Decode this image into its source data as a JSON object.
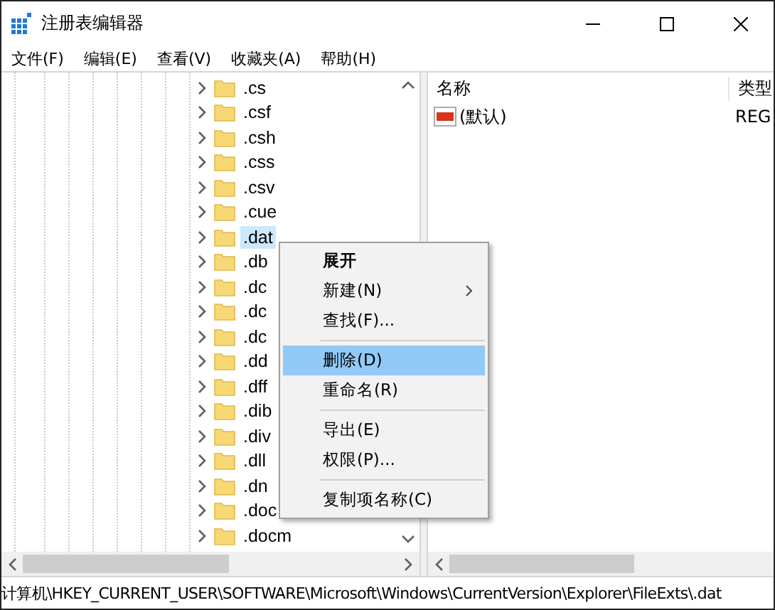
{
  "window": {
    "title": "注册表编辑器"
  },
  "menu_bar": [
    "文件(F)",
    "编辑(E)",
    "查看(V)",
    "收藏夹(A)",
    "帮助(H)"
  ],
  "tree": {
    "items": [
      {
        "label": ".cs",
        "selected": false
      },
      {
        "label": ".csf",
        "selected": false
      },
      {
        "label": ".csh",
        "selected": false
      },
      {
        "label": ".css",
        "selected": false
      },
      {
        "label": ".csv",
        "selected": false
      },
      {
        "label": ".cue",
        "selected": false
      },
      {
        "label": ".dat",
        "selected": true
      },
      {
        "label": ".db",
        "selected": false
      },
      {
        "label": ".dc",
        "selected": false
      },
      {
        "label": ".dc",
        "selected": false
      },
      {
        "label": ".dc",
        "selected": false
      },
      {
        "label": ".dd",
        "selected": false
      },
      {
        "label": ".dff",
        "selected": false
      },
      {
        "label": ".dib",
        "selected": false
      },
      {
        "label": ".div",
        "selected": false
      },
      {
        "label": ".dll",
        "selected": false
      },
      {
        "label": ".dn",
        "selected": false
      },
      {
        "label": ".doc",
        "selected": false
      },
      {
        "label": ".docm",
        "selected": false
      }
    ]
  },
  "context_menu": [
    {
      "kind": "item",
      "label": "展开",
      "bold": true,
      "submenu": false,
      "selected": false
    },
    {
      "kind": "item",
      "label": "新建(N)",
      "bold": false,
      "submenu": true,
      "selected": false
    },
    {
      "kind": "item",
      "label": "查找(F)...",
      "bold": false,
      "submenu": false,
      "selected": false
    },
    {
      "kind": "separator"
    },
    {
      "kind": "item",
      "label": "删除(D)",
      "bold": false,
      "submenu": false,
      "selected": true
    },
    {
      "kind": "item",
      "label": "重命名(R)",
      "bold": false,
      "submenu": false,
      "selected": false
    },
    {
      "kind": "separator"
    },
    {
      "kind": "item",
      "label": "导出(E)",
      "bold": false,
      "submenu": false,
      "selected": false
    },
    {
      "kind": "item",
      "label": "权限(P)...",
      "bold": false,
      "submenu": false,
      "selected": false
    },
    {
      "kind": "separator"
    },
    {
      "kind": "item",
      "label": "复制项名称(C)",
      "bold": false,
      "submenu": false,
      "selected": false
    }
  ],
  "values": {
    "columns": [
      "名称",
      "类型"
    ],
    "rows": [
      {
        "name": "(默认)",
        "type": "REG"
      }
    ]
  },
  "status_bar": "计算机\\HKEY_CURRENT_USER\\SOFTWARE\\Microsoft\\Windows\\CurrentVersion\\Explorer\\FileExts\\.dat"
}
